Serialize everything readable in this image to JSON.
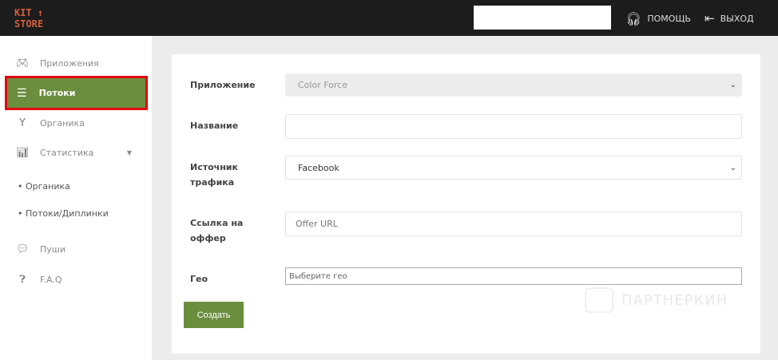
{
  "header": {
    "logo_line1": "KIT ↑",
    "logo_line2": "STORE",
    "search_value": "",
    "help_label": "ПОМОЩЬ",
    "logout_label": "ВЫХОД"
  },
  "sidebar": {
    "items": [
      {
        "label": "Приложения",
        "icon": "gamepad-icon"
      },
      {
        "label": "Потоки",
        "icon": "list-icon",
        "active": true
      },
      {
        "label": "Органика",
        "icon": "sprout-icon"
      },
      {
        "label": "Статистика",
        "icon": "bar-chart-icon"
      },
      {
        "label": "Органика"
      },
      {
        "label": "Потоки/Диплинки"
      },
      {
        "label": "Пуши",
        "icon": "chat-icon"
      },
      {
        "label": "F.A.Q",
        "icon": "question-icon"
      }
    ]
  },
  "form": {
    "app_label": "Приложение",
    "app_value": "Color Force",
    "name_label": "Название",
    "name_value": "",
    "source_label_1": "Источник",
    "source_label_2": "трафика",
    "source_value": "Facebook",
    "offer_label_1": "Ссылка на",
    "offer_label_2": "оффер",
    "offer_placeholder": "Offer URL",
    "geo_label": "Гео",
    "geo_placeholder": "Выберите гео",
    "submit_label": "Создать"
  },
  "watermark": "ПАРТНЕРКИН",
  "colors": {
    "accent": "#6b8e3e",
    "highlight": "#e4000f",
    "header": "#1c1c1c",
    "logo": "#d2603a"
  }
}
